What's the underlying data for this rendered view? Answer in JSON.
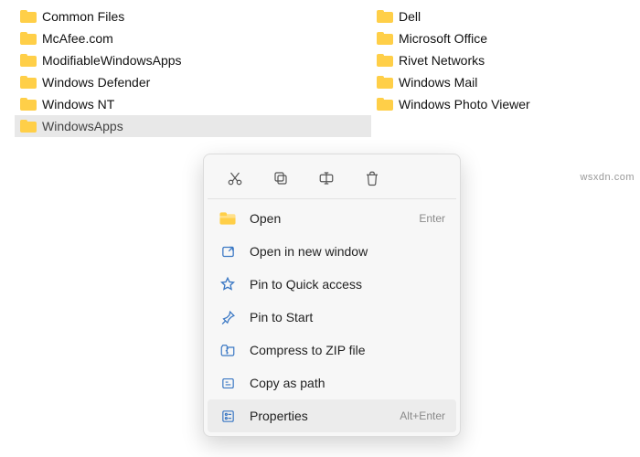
{
  "files": {
    "col1": [
      {
        "name": "Common Files"
      },
      {
        "name": "McAfee.com"
      },
      {
        "name": "ModifiableWindowsApps"
      },
      {
        "name": "Windows Defender"
      },
      {
        "name": "Windows NT"
      },
      {
        "name": "WindowsApps",
        "selected": true
      }
    ],
    "col2": [
      {
        "name": "Dell"
      },
      {
        "name": "Microsoft Office"
      },
      {
        "name": "Rivet Networks"
      },
      {
        "name": "Windows Mail"
      },
      {
        "name": "Windows Photo Viewer"
      }
    ]
  },
  "contextMenu": {
    "topActions": [
      "cut",
      "copy",
      "rename",
      "delete"
    ],
    "items": [
      {
        "icon": "folder-open",
        "label": "Open",
        "shortcut": "Enter"
      },
      {
        "icon": "open-new",
        "label": "Open in new window",
        "shortcut": ""
      },
      {
        "icon": "star",
        "label": "Pin to Quick access",
        "shortcut": ""
      },
      {
        "icon": "pin",
        "label": "Pin to Start",
        "shortcut": ""
      },
      {
        "icon": "zip",
        "label": "Compress to ZIP file",
        "shortcut": ""
      },
      {
        "icon": "copypath",
        "label": "Copy as path",
        "shortcut": ""
      },
      {
        "icon": "props",
        "label": "Properties",
        "shortcut": "Alt+Enter",
        "highlight": true
      }
    ]
  },
  "watermark": "wsxdn.com"
}
